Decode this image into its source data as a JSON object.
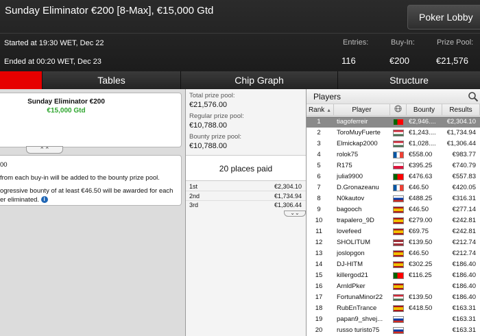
{
  "header": {
    "title": "Sunday Eliminator €200 [8-Max], €15,000 Gtd",
    "lobby_button": "Poker Lobby",
    "started": "Started at 19:30 WET, Dec 22",
    "ended": "Ended at 00:20 WET, Dec 23",
    "entries_label": "Entries:",
    "entries": "116",
    "buyin_label": "Buy-In:",
    "buyin": "€200",
    "prizepool_label": "Prize Pool:",
    "prizepool": "€21,576"
  },
  "tabs": [
    "",
    "Tables",
    "Chip Graph",
    "Structure"
  ],
  "colors": {
    "accent": "#e60000",
    "gtd_green": "#2da52d",
    "selected_row": "#8a8a8a"
  },
  "tournament_card": {
    "name": "Sunday Eliminator €200",
    "guarantee": "€15,000 Gtd"
  },
  "description": {
    "line1": "00",
    "line2": "from each buy-in will be added to the bounty prize pool.",
    "line3": "ogressive bounty of at least €46.50 will be awarded for each",
    "line4": "er eliminated.",
    "info_icon": "info-icon"
  },
  "prizes": {
    "total_label": "Total prize pool:",
    "total": "€21,576.00",
    "regular_label": "Regular prize pool:",
    "regular": "€10,788.00",
    "bounty_label": "Bounty prize pool:",
    "bounty": "€10,788.00",
    "places_paid": "20 places paid",
    "payouts": [
      {
        "place": "1st",
        "amount": "€2,304.10"
      },
      {
        "place": "2nd",
        "amount": "€1,734.94"
      },
      {
        "place": "3rd",
        "amount": "€1,306.44"
      }
    ]
  },
  "players_panel": {
    "title": "Players",
    "columns": {
      "rank": "Rank",
      "player": "Player",
      "country": "globe-icon",
      "bounty": "Bounty",
      "results": "Results"
    },
    "rows": [
      {
        "rank": "1",
        "name": "tiagoferreir",
        "flag": "portugal",
        "bounty": "€2,946....",
        "result": "€2,304.10"
      },
      {
        "rank": "2",
        "name": "ToroMuyFuerte",
        "flag": "hungary",
        "bounty": "€1,243....",
        "result": "€1,734.94"
      },
      {
        "rank": "3",
        "name": "Elmickap2000",
        "flag": "hungary",
        "bounty": "€1,028....",
        "result": "€1,306.44"
      },
      {
        "rank": "4",
        "name": "rolok75",
        "flag": "france",
        "bounty": "€558.00",
        "result": "€983.77"
      },
      {
        "rank": "5",
        "name": "R175",
        "flag": "poland",
        "bounty": "€395.25",
        "result": "€740.79"
      },
      {
        "rank": "6",
        "name": "julia9900",
        "flag": "portugal",
        "bounty": "€476.63",
        "result": "€557.83"
      },
      {
        "rank": "7",
        "name": "D.Gronazeanu",
        "flag": "france",
        "bounty": "€46.50",
        "result": "€420.05"
      },
      {
        "rank": "8",
        "name": "N0kautov",
        "flag": "russia",
        "bounty": "€488.25",
        "result": "€316.31"
      },
      {
        "rank": "9",
        "name": "bagooch",
        "flag": "spain",
        "bounty": "€46.50",
        "result": "€277.14"
      },
      {
        "rank": "10",
        "name": "trapalero_9D",
        "flag": "spain",
        "bounty": "€279.00",
        "result": "€242.81"
      },
      {
        "rank": "11",
        "name": "lovefeed",
        "flag": "spain",
        "bounty": "€69.75",
        "result": "€242.81"
      },
      {
        "rank": "12",
        "name": "SHOLITUM",
        "flag": "latvia",
        "bounty": "€139.50",
        "result": "€212.74"
      },
      {
        "rank": "13",
        "name": "joslopgon",
        "flag": "spain",
        "bounty": "€46.50",
        "result": "€212.74"
      },
      {
        "rank": "14",
        "name": "DJ-HITM",
        "flag": "spain",
        "bounty": "€302.25",
        "result": "€186.40"
      },
      {
        "rank": "15",
        "name": "killergod21",
        "flag": "portugal",
        "bounty": "€116.25",
        "result": "€186.40"
      },
      {
        "rank": "16",
        "name": "ArnldPker",
        "flag": "spain",
        "bounty": "",
        "result": "€186.40"
      },
      {
        "rank": "17",
        "name": "FortunaMinor22",
        "flag": "hungary",
        "bounty": "€139.50",
        "result": "€186.40"
      },
      {
        "rank": "18",
        "name": "RubEnTrance",
        "flag": "spain",
        "bounty": "€418.50",
        "result": "€163.31"
      },
      {
        "rank": "19",
        "name": "papan9_shvej...",
        "flag": "russia",
        "bounty": "",
        "result": "€163.31"
      },
      {
        "rank": "20",
        "name": "russo turisto75",
        "flag": "russia",
        "bounty": "",
        "result": "€163.31"
      }
    ]
  }
}
